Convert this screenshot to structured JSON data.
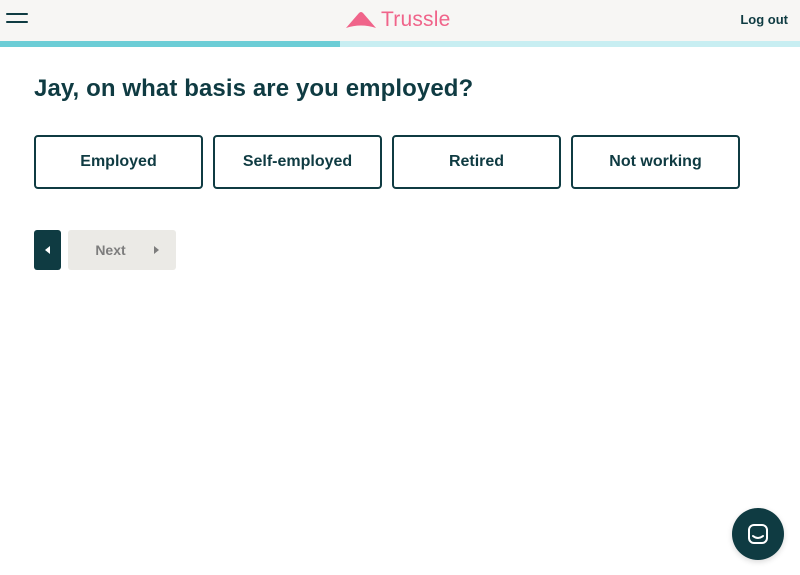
{
  "header": {
    "brand": "Trussle",
    "logout_label": "Log out",
    "menu_icon": "hamburger-menu-icon",
    "brand_color": "#f0648a"
  },
  "progress": {
    "fraction": 0.425,
    "fill_color": "#6ccdd6",
    "track_color": "#c8eef2"
  },
  "question": {
    "text": "Jay, on what basis are you employed?"
  },
  "options": [
    {
      "label": "Employed"
    },
    {
      "label": "Self-employed"
    },
    {
      "label": "Retired"
    },
    {
      "label": "Not working"
    }
  ],
  "navigation": {
    "back_icon": "triangle-left-icon",
    "next_label": "Next",
    "next_icon": "triangle-right-icon"
  },
  "chat": {
    "icon": "chat-icon"
  },
  "colors": {
    "primary": "#0f3b42",
    "disabled_bg": "#ebeae6",
    "disabled_text": "#7d7d7d"
  }
}
